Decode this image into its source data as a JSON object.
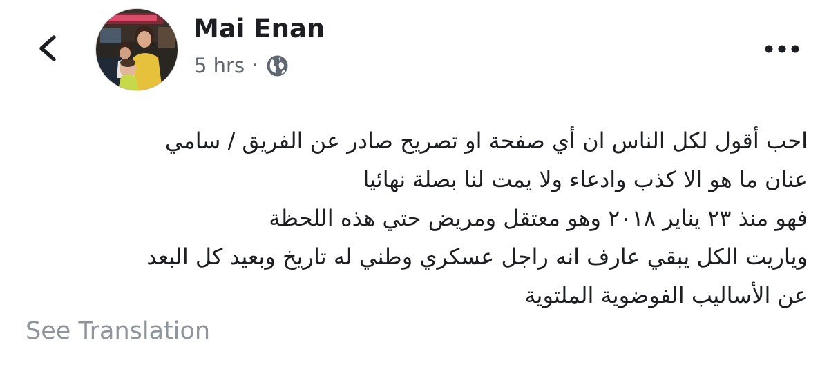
{
  "header": {
    "back_icon": "chevron-left-icon",
    "author_name": "Mai Enan",
    "timestamp": "5 hrs",
    "separator": "·",
    "privacy_icon": "globe-icon",
    "more_icon": "more-horizontal-icon"
  },
  "post": {
    "lines": [
      "احب أقول لكل الناس ان أي صفحة او تصريح صادر عن الفريق /  سامي",
      "عنان ما هو الا كذب وادعاء ولا يمت لنا بصلة نهائيا",
      "فهو منذ ٢٣ يناير ٢٠١٨ وهو معتقل ومريض حتي هذه اللحظة",
      "وياريت الكل يبقي عارف انه راجل عسكري وطني له تاريخ وبعيد كل البعد",
      "عن الأساليب الفوضوية الملتوية"
    ]
  },
  "footer": {
    "see_translation": "See Translation"
  },
  "colors": {
    "text": "#1c1e21",
    "secondary": "#606770",
    "muted": "#90949c",
    "background": "#ffffff"
  }
}
